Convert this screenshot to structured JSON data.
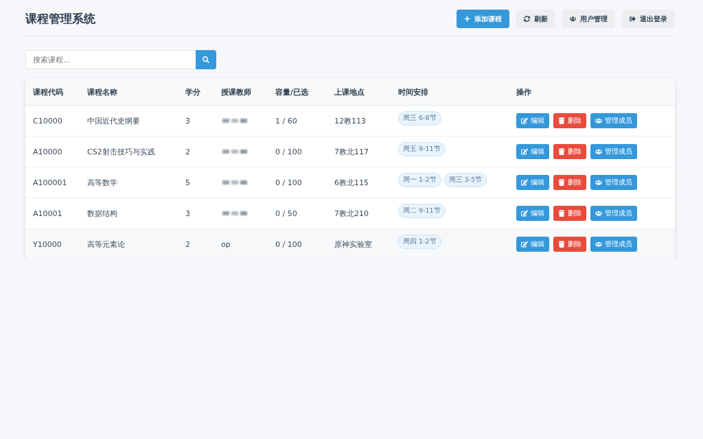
{
  "header": {
    "title": "课程管理系统",
    "buttons": [
      {
        "label": "添加课程",
        "kind": "primary"
      },
      {
        "label": "刷新",
        "kind": "secondary"
      },
      {
        "label": "用户管理",
        "kind": "secondary"
      },
      {
        "label": "退出登录",
        "kind": "secondary"
      }
    ]
  },
  "search": {
    "placeholder": "搜索课程..."
  },
  "table": {
    "columns": [
      "课程代码",
      "课程名称",
      "学分",
      "授课教师",
      "容量/已选",
      "上课地点",
      "时间安排",
      "操作"
    ],
    "rows": [
      {
        "code": "C10000",
        "name": "中国近代史纲要",
        "credit": "3",
        "teacher_redacted": true,
        "capacity": "1 / 60",
        "location": "12教113",
        "schedule": [
          "周三 6-8节"
        ],
        "hovered": false,
        "actions": [
          "编辑",
          "删除",
          "管理成员"
        ]
      },
      {
        "code": "A10000",
        "name": "CS2射击技巧与实践",
        "credit": "2",
        "teacher_redacted": true,
        "capacity": "0 / 100",
        "location": "7教北117",
        "schedule": [
          "周五 9-11节"
        ],
        "hovered": false,
        "actions": [
          "编辑",
          "删除",
          "管理成员"
        ]
      },
      {
        "code": "A100001",
        "name": "高等数学",
        "credit": "5",
        "teacher_redacted": true,
        "capacity": "0 / 100",
        "location": "6教北115",
        "schedule": [
          "周一 1-2节",
          "周三 3-5节"
        ],
        "hovered": false,
        "actions": [
          "编辑",
          "删除",
          "管理成员"
        ]
      },
      {
        "code": "A10001",
        "name": "数据结构",
        "credit": "3",
        "teacher_redacted": true,
        "capacity": "0 / 50",
        "location": "7教北210",
        "schedule": [
          "周二 9-11节"
        ],
        "hovered": false,
        "actions": [
          "编辑",
          "删除",
          "管理成员"
        ]
      },
      {
        "code": "Y10000",
        "name": "高等元素论",
        "credit": "2",
        "teacher": "op",
        "teacher_redacted": false,
        "capacity": "0 / 100",
        "location": "原神实验室",
        "schedule": [
          "周四 1-2节"
        ],
        "hovered": true,
        "actions": [
          "编辑",
          "删除",
          "管理成员"
        ]
      }
    ]
  }
}
